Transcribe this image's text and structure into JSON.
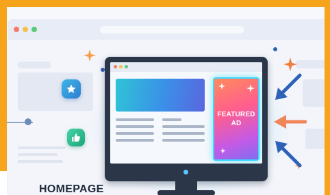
{
  "title": "HOMEPAGE",
  "ad": {
    "line1": "FEATURED",
    "line2": "AD"
  },
  "icons": {
    "badge_top": "star-icon",
    "badge_bottom": "thumbs-up-icon",
    "arrows": [
      "arrow-down-left-icon",
      "arrow-left-icon",
      "arrow-up-left-icon"
    ]
  },
  "colors": {
    "frame": "#f7a41d",
    "monitor": "#2b3648",
    "ad_border": "#3ad8ff",
    "arrow_blue": "#2e62b8",
    "arrow_orange": "#f0855a"
  }
}
